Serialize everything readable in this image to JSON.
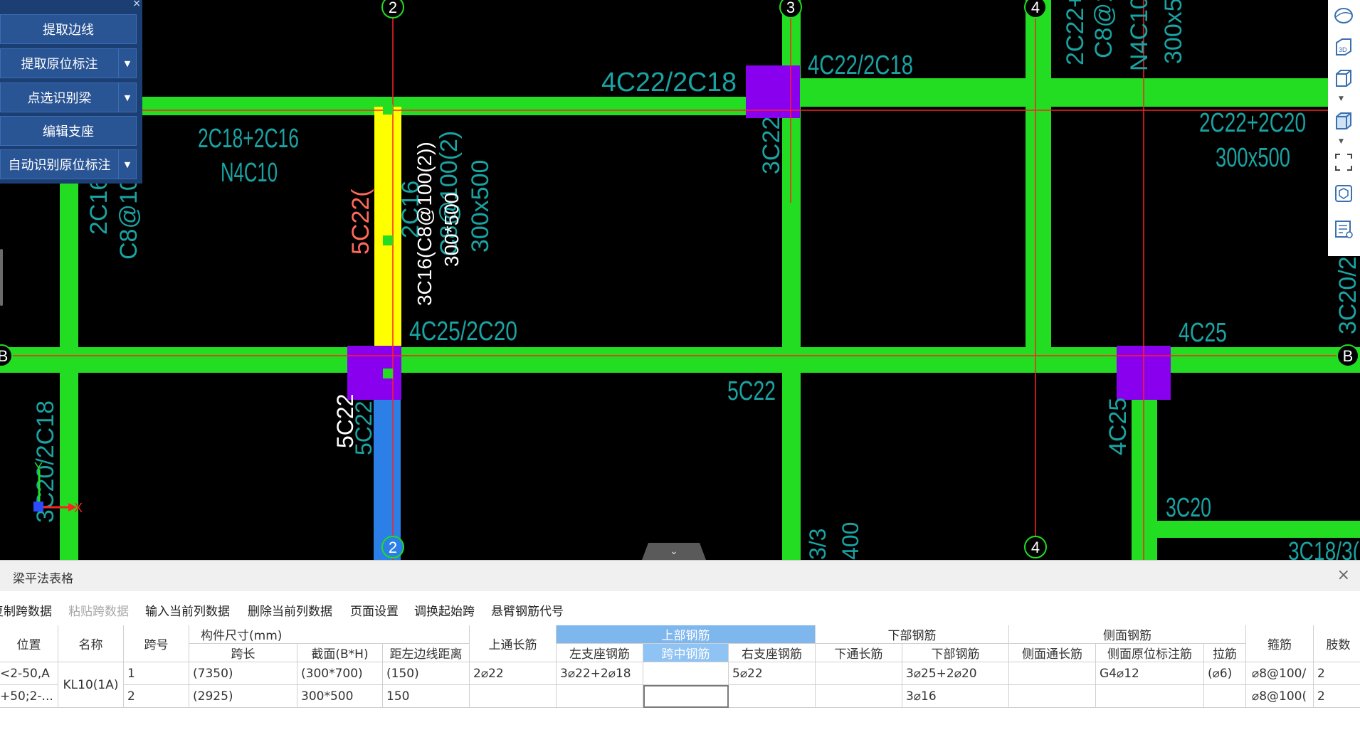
{
  "tool_panel": {
    "buttons": [
      {
        "label": "提取边线",
        "dropdown": false
      },
      {
        "label": "提取原位标注",
        "dropdown": true
      },
      {
        "label": "点选识别梁",
        "dropdown": true
      },
      {
        "label": "编辑支座",
        "dropdown": false
      },
      {
        "label": "自动识别原位标注",
        "dropdown": true
      }
    ]
  },
  "cad": {
    "axis_labels": {
      "a2_top": "2",
      "a3_top": "3",
      "a4_top": "4",
      "a2_bottom": "2",
      "a4_bottom": "4",
      "b_left": "B",
      "b_right": "B"
    },
    "labels": {
      "t1": "4C22/2C18",
      "t2": "4C22/2C18",
      "t3": "2C18+2C16",
      "t4": "N4C10",
      "t5": "2C16",
      "t6": "C8@100(",
      "t7": "5C22(",
      "t8": "3C16(C8@100(2))",
      "t9": "300*500",
      "t10": "2C16",
      "t11": "C8@100(2)",
      "t12": "300x500",
      "t13": "3C22",
      "t14": "4C25/2C20",
      "t15": "5C22",
      "t16": "5C22",
      "t17": "5C22",
      "t18": "2C22+2",
      "t19": "C8@100",
      "t20": "N4C10",
      "t21": "300x50",
      "t22": "2C22+2C20",
      "t23": "300x500",
      "t24": "4C25",
      "t25": "4C25",
      "t26": "3C20",
      "t27": "3C18/3(",
      "t28": "3C20/2C",
      "t29": "3C20/2C18",
      "t30": "3/3",
      "t31": "400"
    },
    "axis_indicator": {
      "y": "Y",
      "x": "X"
    },
    "colors": {
      "beam": "#22dd22",
      "column": "#8800ee",
      "selected_beam": "#ffff00",
      "blue_beam": "#2b7fe6",
      "axis_line": "#ff2020",
      "annotation": "#1aa3a3"
    }
  },
  "right_toolbar": {
    "icons": [
      "sphere-icon",
      "3d-view-icon",
      "cube-outline-icon",
      "cube-filled-icon",
      "fullscreen-icon",
      "layer-icon",
      "properties-icon"
    ],
    "label_3d": "3D"
  },
  "collapse_tab": {
    "glyph": "⌄"
  },
  "table_panel": {
    "title": "梁平法表格",
    "close": "×",
    "toolbar": [
      {
        "label": "复制跨数据",
        "disabled": false
      },
      {
        "label": "粘贴跨数据",
        "disabled": true
      },
      {
        "label": "输入当前列数据",
        "disabled": false
      },
      {
        "label": "删除当前列数据",
        "disabled": false
      },
      {
        "label": "页面设置",
        "disabled": false
      },
      {
        "label": "调换起始跨",
        "disabled": false
      },
      {
        "label": "悬臂钢筋代号",
        "disabled": false
      }
    ],
    "headers": {
      "position": "位置",
      "name": "名称",
      "span_no": "跨号",
      "size_group": "构件尺寸(mm)",
      "span_len": "跨长",
      "section": "截面(B*H)",
      "edge_dist": "距左边线距离",
      "top_through": "上通长筋",
      "top_group": "上部钢筋",
      "left_support": "左支座钢筋",
      "mid_span": "跨中钢筋",
      "right_support": "右支座钢筋",
      "bottom_group": "下部钢筋",
      "bottom_through": "下通长筋",
      "bottom_bar": "下部钢筋",
      "side_group": "侧面钢筋",
      "side_through": "侧面通长筋",
      "side_in_situ": "侧面原位标注筋",
      "tie": "拉筋",
      "stirrup": "箍筋",
      "limb": "肢数"
    },
    "rows": [
      {
        "position": "<2-50,A",
        "name": "KL10(1A)",
        "span_no": "1",
        "span_len": "(7350)",
        "section": "(300*700)",
        "edge_dist": "(150)",
        "top_through": "2⌀22",
        "left_support": "3⌀22+2⌀18",
        "mid_span": "",
        "right_support": "5⌀22",
        "bottom_through": "",
        "bottom_bar": "3⌀25+2⌀20",
        "side_through": "",
        "side_in_situ": "G4⌀12",
        "tie": "(⌀6)",
        "stirrup": "⌀8@100/",
        "limb": "2"
      },
      {
        "position": "+50;2-...",
        "span_no": "2",
        "span_len": "(2925)",
        "section": "300*500",
        "edge_dist": "150",
        "top_through": "",
        "left_support": "",
        "mid_span": "",
        "right_support": "",
        "bottom_through": "",
        "bottom_bar": "3⌀16",
        "side_through": "",
        "side_in_situ": "",
        "tie": "",
        "stirrup": "⌀8@100(",
        "limb": "2"
      }
    ]
  }
}
